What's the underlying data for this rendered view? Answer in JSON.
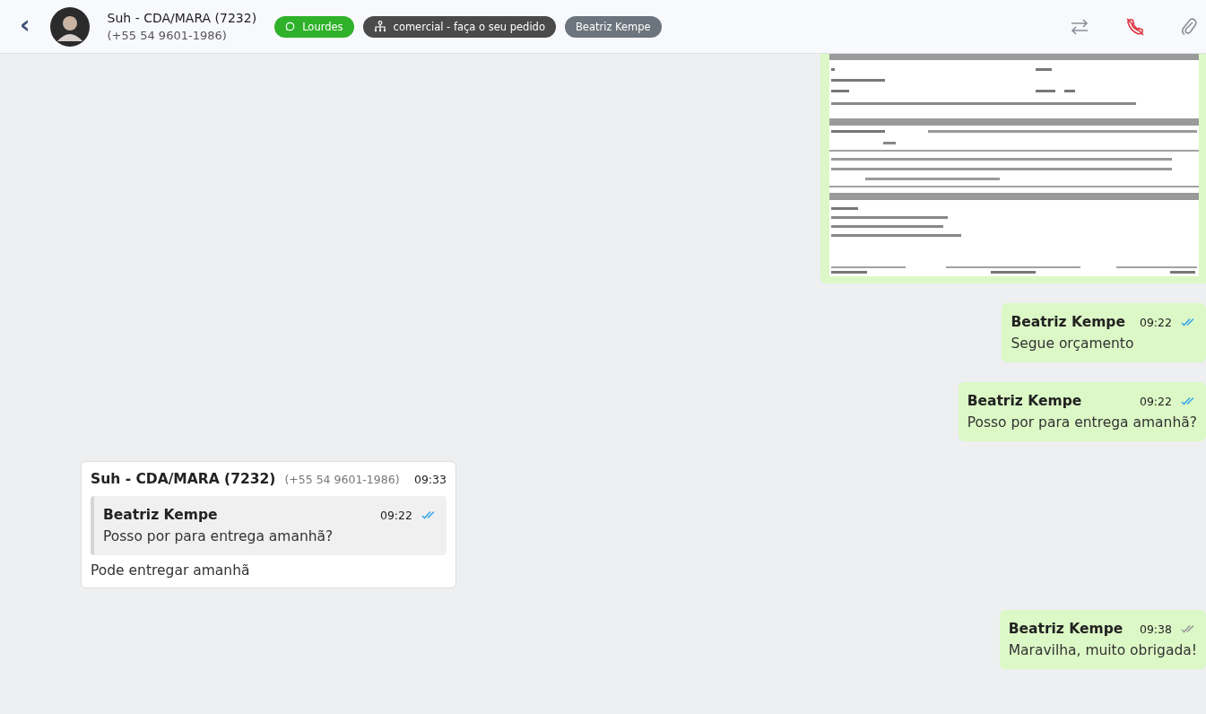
{
  "header": {
    "back": "‹",
    "contact_name": "Suh - CDA/MARA (7232)",
    "contact_phone": "(+55 54 9601-1986)",
    "tags": [
      {
        "label": "Lourdes",
        "kind": "whatsapp",
        "color": "#2fb12a"
      },
      {
        "label": "comercial - faça o seu pedido",
        "kind": "queue",
        "color": "#4a4a4a"
      },
      {
        "label": "Beatriz Kempe",
        "kind": "user",
        "color": "#6c757d"
      }
    ]
  },
  "messages": [
    {
      "kind": "image"
    },
    {
      "kind": "outgoing",
      "author": "Beatriz Kempe",
      "time": "09:22",
      "read": true,
      "text": "Segue orçamento"
    },
    {
      "kind": "outgoing",
      "author": "Beatriz Kempe",
      "time": "09:22",
      "read": true,
      "text": "Posso por para entrega amanhã?"
    },
    {
      "kind": "incoming",
      "author": "Suh - CDA/MARA (7232)",
      "phone": "(+55 54 9601-1986)",
      "time": "09:33",
      "quote": {
        "author": "Beatriz Kempe",
        "time": "09:22",
        "read": true,
        "text": "Posso por para entrega amanhã?"
      },
      "text": "Pode entregar amanhã"
    },
    {
      "kind": "outgoing",
      "author": "Beatriz Kempe",
      "time": "09:38",
      "read": false,
      "text": "Maravilha, muito obrigada!"
    }
  ]
}
